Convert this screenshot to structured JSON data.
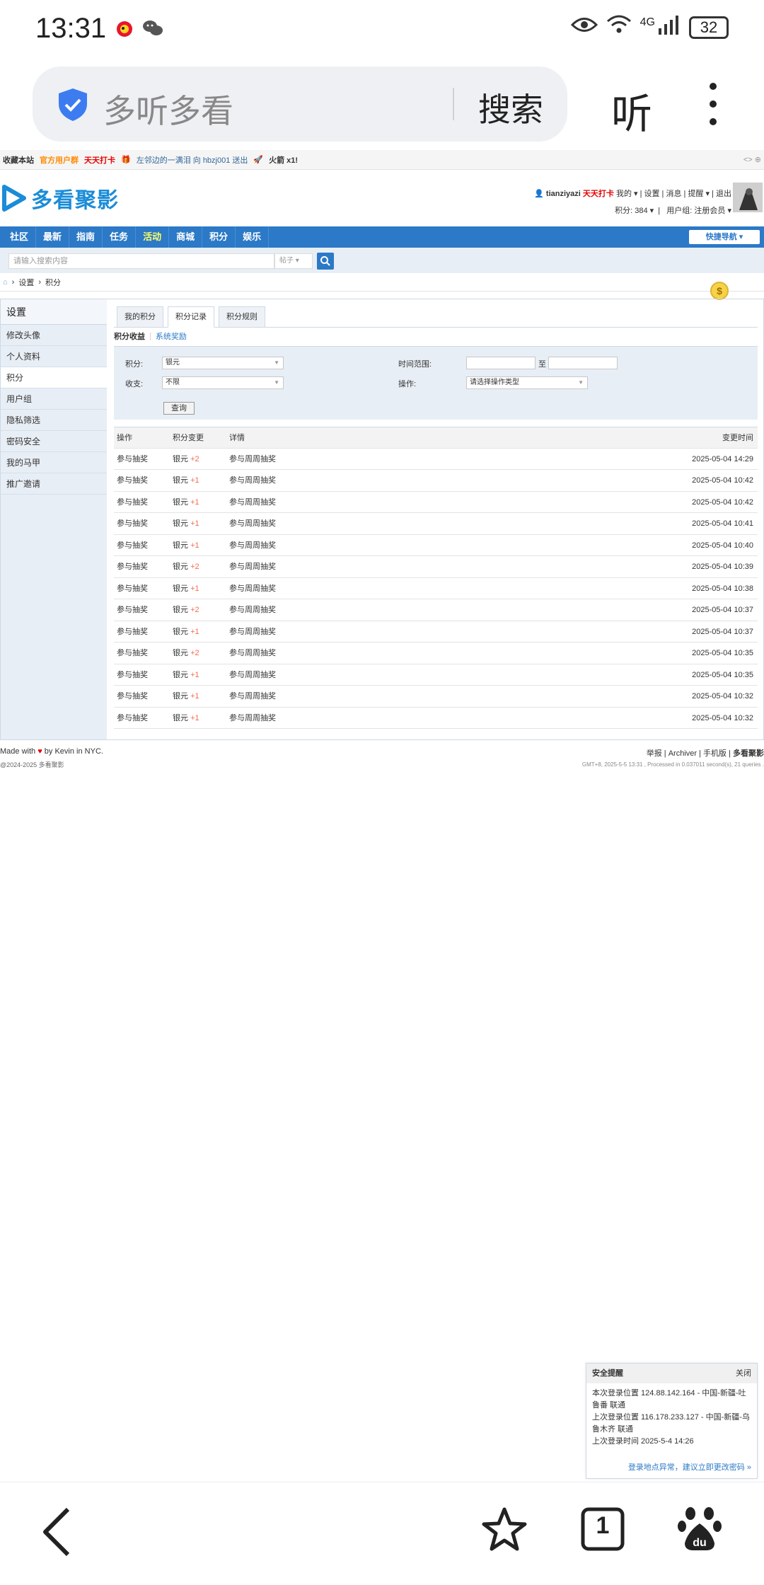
{
  "status_bar": {
    "time": "13:31",
    "network": "4G",
    "battery": "32"
  },
  "browser": {
    "address_text": "多听多看",
    "search_label": "搜索",
    "listen_label": "听"
  },
  "top_notice": {
    "bookmark": "收藏本站",
    "official_group": "官方用户群",
    "checkin": "天天打卡",
    "gift_msg": "左邻边的一满泪 向 hbzj001 送出",
    "rocket": "火箭 x1!",
    "right_icons": "<> ⊕"
  },
  "header": {
    "logo_text": "多看聚影",
    "username": "tianziyazi",
    "checkin": "天天打卡",
    "links": "我的 ▾ | 设置 | 消息 | 提醒 ▾ | 退出",
    "points": "积分: 384 ▾",
    "group": "用户组: 注册会员 ▾"
  },
  "nav": {
    "items": [
      "社区",
      "最新",
      "指南",
      "任务",
      "活动",
      "商城",
      "积分",
      "娱乐"
    ],
    "active": "活动",
    "quick_nav": "快捷导航 ▾"
  },
  "search": {
    "placeholder": "请输入搜索内容",
    "type": "帖子 ▾"
  },
  "breadcrumb": {
    "items": [
      "设置",
      "积分"
    ]
  },
  "sidebar": {
    "title": "设置",
    "items": [
      "修改头像",
      "个人资料",
      "积分",
      "用户组",
      "隐私筛选",
      "密码安全",
      "我的马甲",
      "推广邀请"
    ],
    "active": "积分"
  },
  "tabs": [
    "我的积分",
    "积分记录",
    "积分规则"
  ],
  "active_tab": "积分记录",
  "subtabs": {
    "on": "积分收益",
    "off": "系统奖励"
  },
  "filter": {
    "points_label": "积分:",
    "points_value": "银元",
    "income_label": "收支:",
    "income_value": "不限",
    "time_label": "时间范围:",
    "to_label": "至",
    "op_label": "操作:",
    "op_value": "请选择操作类型",
    "query_button": "查询"
  },
  "records": {
    "headers": [
      "操作",
      "积分变更",
      "详情",
      "变更时间"
    ],
    "rows": [
      {
        "op": "参与抽奖",
        "unit": "银元",
        "change": "+2",
        "detail": "参与周周抽奖",
        "time": "2025-05-04 14:29"
      },
      {
        "op": "参与抽奖",
        "unit": "银元",
        "change": "+1",
        "detail": "参与周周抽奖",
        "time": "2025-05-04 10:42"
      },
      {
        "op": "参与抽奖",
        "unit": "银元",
        "change": "+1",
        "detail": "参与周周抽奖",
        "time": "2025-05-04 10:42"
      },
      {
        "op": "参与抽奖",
        "unit": "银元",
        "change": "+1",
        "detail": "参与周周抽奖",
        "time": "2025-05-04 10:41"
      },
      {
        "op": "参与抽奖",
        "unit": "银元",
        "change": "+1",
        "detail": "参与周周抽奖",
        "time": "2025-05-04 10:40"
      },
      {
        "op": "参与抽奖",
        "unit": "银元",
        "change": "+2",
        "detail": "参与周周抽奖",
        "time": "2025-05-04 10:39"
      },
      {
        "op": "参与抽奖",
        "unit": "银元",
        "change": "+1",
        "detail": "参与周周抽奖",
        "time": "2025-05-04 10:38"
      },
      {
        "op": "参与抽奖",
        "unit": "银元",
        "change": "+2",
        "detail": "参与周周抽奖",
        "time": "2025-05-04 10:37"
      },
      {
        "op": "参与抽奖",
        "unit": "银元",
        "change": "+1",
        "detail": "参与周周抽奖",
        "time": "2025-05-04 10:37"
      },
      {
        "op": "参与抽奖",
        "unit": "银元",
        "change": "+2",
        "detail": "参与周周抽奖",
        "time": "2025-05-04 10:35"
      },
      {
        "op": "参与抽奖",
        "unit": "银元",
        "change": "+1",
        "detail": "参与周周抽奖",
        "time": "2025-05-04 10:35"
      },
      {
        "op": "参与抽奖",
        "unit": "银元",
        "change": "+1",
        "detail": "参与周周抽奖",
        "time": "2025-05-04 10:32"
      },
      {
        "op": "参与抽奖",
        "unit": "银元",
        "change": "+1",
        "detail": "参与周周抽奖",
        "time": "2025-05-04 10:32"
      }
    ]
  },
  "footer": {
    "made_prefix": "Made with",
    "made_suffix": "by Kevin in NYC.",
    "copyright": "@2024-2025 多看聚影",
    "links": "举报 | Archiver | 手机版 |",
    "site_name": "多看聚影",
    "gmt": "GMT+8, 2025-5-5 13:31 , Processed in 0.037011 second(s), 21 queries ."
  },
  "security_popup": {
    "title": "安全提醒",
    "close": "关闭",
    "line1": "本次登录位置 124.88.142.164 - 中国-新疆-吐鲁番 联通",
    "line2": "上次登录位置 116.178.233.127 - 中国-新疆-乌鲁木齐 联通",
    "line3": "上次登录时间 2025-5-4 14:26",
    "link": "登录地点异常，建议立即更改密码 »"
  },
  "colors": {
    "brand_blue": "#2b79c7",
    "logo_blue": "#1a8cd8",
    "accent_red": "#e60000",
    "points_orange": "#f26c4f"
  },
  "icons": {
    "status": [
      "weibo-icon",
      "wechat-icon",
      "eye-icon",
      "wifi-icon",
      "signal-icon",
      "battery-icon"
    ],
    "browser": [
      "shield-icon",
      "more-icon"
    ],
    "bottom_nav": [
      "back-icon",
      "star-icon",
      "tabs-icon",
      "baidu-paw-icon"
    ]
  },
  "bottom_nav": {
    "tab_count": "1"
  }
}
